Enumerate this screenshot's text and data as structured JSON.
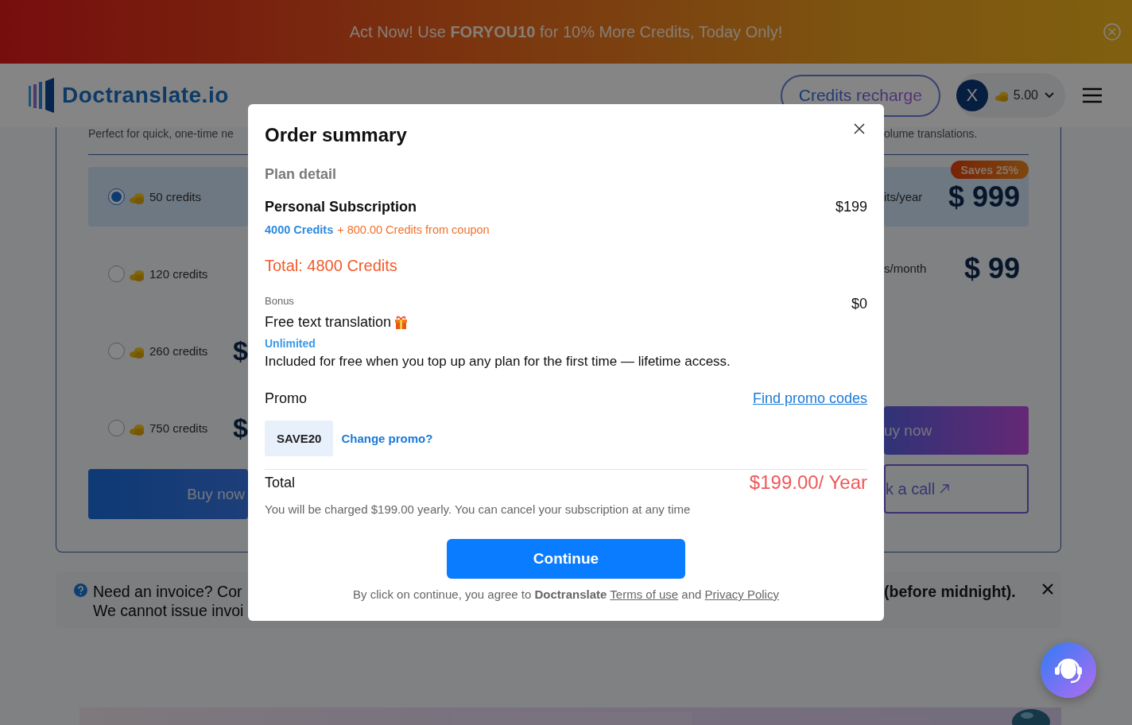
{
  "promo_banner": {
    "text": "Act Now! Use **FORYOU10** for 10% More Credits, Today Only!"
  },
  "header": {
    "logo": "Doctranslate.io",
    "recharge_button": "Credits recharge",
    "avatar": "X",
    "balance": "5.00"
  },
  "plans": {
    "left": {
      "description": "Perfect for quick, one-time ne",
      "options": [
        {
          "label": "50 credits",
          "selected": true
        },
        {
          "label": "120 credits",
          "selected": false
        },
        {
          "label": "260 credits",
          "price": "$",
          "selected": false
        },
        {
          "label": "750 credits",
          "price": "$",
          "selected": false
        }
      ],
      "buy_button": "Buy now"
    },
    "right": {
      "description": "olume translations.",
      "options": [
        {
          "label": "its/year",
          "price": "$ 999",
          "badge": "Saves 25%",
          "selected": true
        },
        {
          "label": "s/month",
          "price": "$ 99",
          "selected": false
        }
      ],
      "buy_button": "uy now",
      "call_button": "k a call"
    }
  },
  "notice": {
    "line_1": "Need an invoice? Cor",
    "line_2": "We cannot issue invoi",
    "right_text": "(before midnight)."
  },
  "modal": {
    "title": "Order summary",
    "section": "Plan detail",
    "plan": {
      "name": "Personal Subscription",
      "price": "$199",
      "credits": "4000 Credits",
      "coupon": "+ 800.00 Credits from coupon",
      "total": "Total: 4800 Credits"
    },
    "bonus": {
      "label": "Bonus",
      "price": "$0",
      "name": "Free text translation",
      "tag": "Unlimited",
      "description": "Included for free when you top up any plan for the first time — lifetime access."
    },
    "promo": {
      "label": "Promo",
      "link": "Find promo codes",
      "code": "SAVE20",
      "change_link": "Change promo?"
    },
    "total": {
      "label": "Total",
      "price": "$199.00/ Year",
      "note": "You will be charged $199.00 yearly. You can cancel your subscription at any time"
    },
    "continue_button": "Continue",
    "agreement": {
      "before": "By click on continue, you agree to **Doctranslate**",
      "terms_link": "Terms of use",
      "middle": "and",
      "privacy_link": "Privacy Policy"
    }
  }
}
